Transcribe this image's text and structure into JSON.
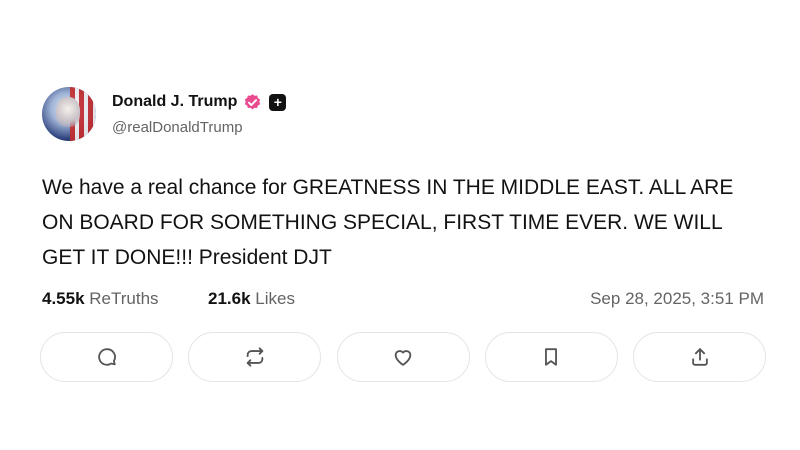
{
  "author": {
    "display_name": "Donald J. Trump",
    "handle": "@realDonaldTrump",
    "verified_icon": "verified-badge-icon",
    "plus_icon": "plus-badge-icon",
    "verified_color": "#ea4b8f"
  },
  "post": {
    "text": "We have a real chance for GREATNESS IN THE MIDDLE EAST. ALL ARE ON BOARD FOR SOMETHING SPECIAL, FIRST TIME EVER. WE WILL GET IT DONE!!! President DJT"
  },
  "stats": {
    "retruths_count": "4.55k",
    "retruths_label": "ReTruths",
    "likes_count": "21.6k",
    "likes_label": "Likes",
    "timestamp": "Sep 28, 2025, 3:51 PM"
  },
  "actions": [
    {
      "icon": "reply-icon"
    },
    {
      "icon": "retruth-icon"
    },
    {
      "icon": "like-icon"
    },
    {
      "icon": "bookmark-icon"
    },
    {
      "icon": "share-icon"
    }
  ]
}
